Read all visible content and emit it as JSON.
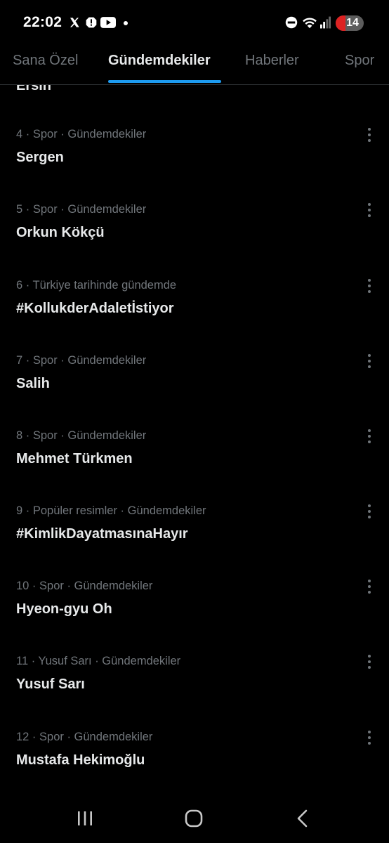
{
  "status_bar": {
    "time": "22:02",
    "left_icons": [
      "x-logo-icon",
      "alert-icon",
      "youtube-icon",
      "notification-dot-icon"
    ],
    "right_icons": [
      "do-not-disturb-icon",
      "wifi-icon",
      "signal-icon"
    ],
    "battery_level": "14",
    "battery_color": "#dd2222"
  },
  "tabs": [
    {
      "label": "Sana Özel",
      "active": false
    },
    {
      "label": "Gündemdekiler",
      "active": true
    },
    {
      "label": "Haberler",
      "active": false
    },
    {
      "label": "Spor",
      "active": false
    }
  ],
  "accent_color": "#1d9bf0",
  "partial_item": "Ersin",
  "trends": [
    {
      "meta": "4 · Spor · Gündemdekiler",
      "title": "Sergen"
    },
    {
      "meta": "5 · Spor · Gündemdekiler",
      "title": "Orkun Kökçü"
    },
    {
      "meta": "6 · Türkiye tarihinde gündemde",
      "title": "#KollukderAdaletİstiyor"
    },
    {
      "meta": "7 · Spor · Gündemdekiler",
      "title": "Salih"
    },
    {
      "meta": "8 · Spor · Gündemdekiler",
      "title": "Mehmet Türkmen"
    },
    {
      "meta": "9 · Popüler resimler · Gündemdekiler",
      "title": "#KimlikDayatmasınaHayır"
    },
    {
      "meta": "10 · Spor · Gündemdekiler",
      "title": "Hyeon-gyu Oh"
    },
    {
      "meta": "11 · Yusuf Sarı · Gündemdekiler",
      "title": "Yusuf Sarı"
    },
    {
      "meta": "12 · Spor · Gündemdekiler",
      "title": "Mustafa Hekimoğlu"
    }
  ],
  "trend_menu_icon": "more-vertical-icon",
  "nav_bar": {
    "icons": [
      "recents-icon",
      "home-icon",
      "back-icon"
    ]
  }
}
